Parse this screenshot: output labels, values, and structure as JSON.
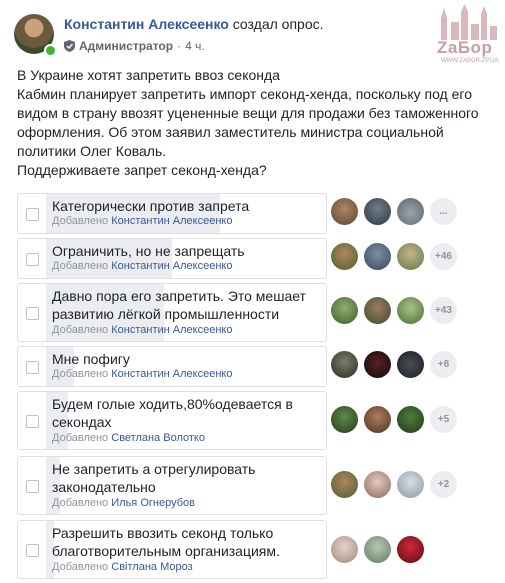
{
  "post": {
    "author": "Константин Алексеенко",
    "action": "создал опрос.",
    "role": "Администратор",
    "separator": "·",
    "time": "4 ч.",
    "lines": [
      "В Украине хотят запретить ввоз секонда",
      "Кабмин планирует запретить импорт секонд-хенда, поскольку под его видом в страну ввозят уцененные вещи для продажи без таможенного оформления. Об этом заявил заместитель министра социальной политики Олег Коваль.",
      "Поддерживаете запрет секонд-хенда?"
    ]
  },
  "watermark": {
    "text": "ZaБор",
    "sub": "WWW.ZABOR.ZP.UA"
  },
  "poll": {
    "added_label": "Добавлено",
    "options": [
      {
        "text": "Категорически против запрета",
        "added_by": "Константин Алексеенко",
        "more": "...",
        "fill": 0.62
      },
      {
        "text": "Ограничить, но не запрещать",
        "added_by": "Константин Алексеенко",
        "more": "+46",
        "fill": 0.45
      },
      {
        "text": "Давно пора его запретить. Это мешает развитию лёгкой промышленности",
        "added_by": "Константин Алексеенко",
        "more": "+43",
        "fill": 0.42
      },
      {
        "text": "Мне пофигу",
        "added_by": "Константин Алексеенко",
        "more": "+8",
        "fill": 0.1
      },
      {
        "text": "Будем голые ходить,80%одевается в секондах",
        "added_by": "Светлана Волотко",
        "more": "+5",
        "fill": 0.08
      },
      {
        "text": "Не запретить а отрегулировать законодательно",
        "added_by": "Илья Огнерубов",
        "more": "+2",
        "fill": 0.05
      },
      {
        "text": "Разрешить ввозить секонд только благотворительным организациям.",
        "added_by": "Світлана Мороз",
        "more": "",
        "fill": 0.03
      }
    ]
  },
  "colors": {
    "link": "#385898",
    "online": "#42b72a",
    "bar": "#ebedf0",
    "border": "#dddfe2"
  }
}
